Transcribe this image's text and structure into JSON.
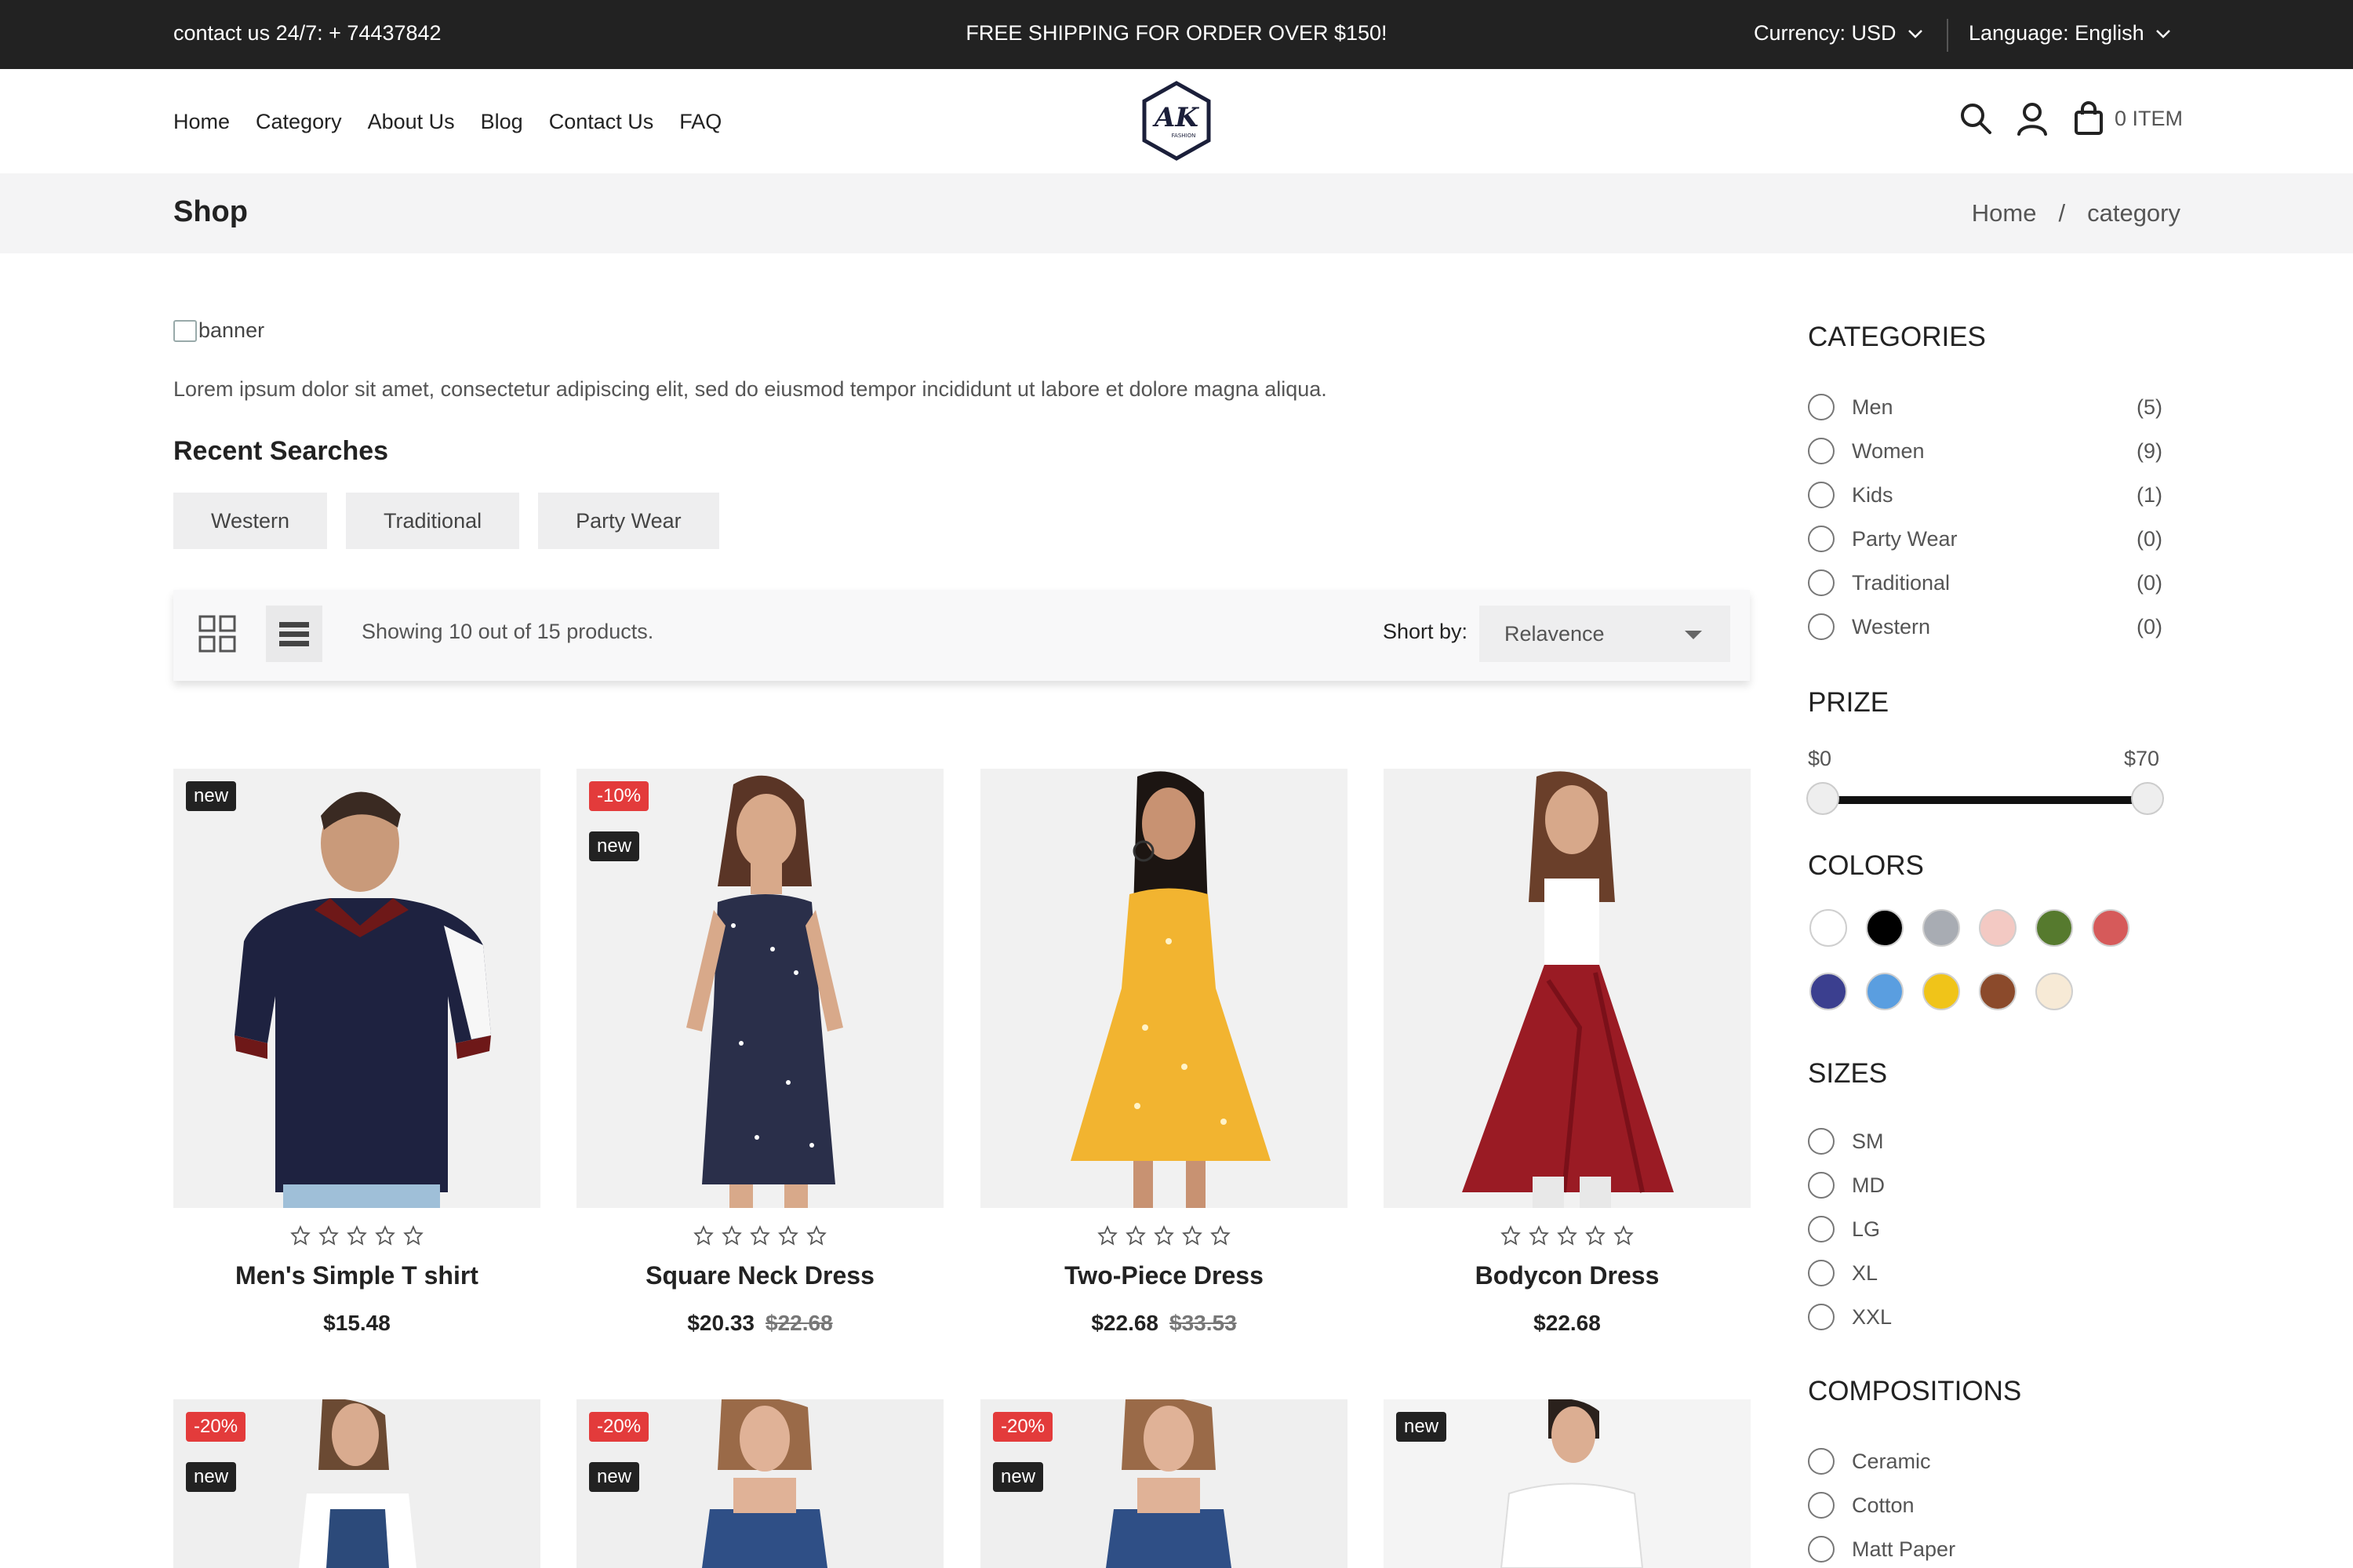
{
  "topbar": {
    "contact": "contact us 24/7: + 74437842",
    "shipping": "FREE SHIPPING FOR ORDER OVER $150!",
    "currency": "Currency: USD",
    "language": "Language: English"
  },
  "nav": {
    "items": [
      "Home",
      "Category",
      "About Us",
      "Blog",
      "Contact Us",
      "FAQ"
    ]
  },
  "logo": {
    "text": "AK",
    "subtext": "FASHION"
  },
  "cart": {
    "label": "0 ITEM"
  },
  "page": {
    "title": "Shop"
  },
  "breadcrumb": {
    "home": "Home",
    "separator": "/",
    "current": "category"
  },
  "banner": {
    "alt": "banner"
  },
  "description": "Lorem ipsum dolor sit amet, consectetur adipiscing elit, sed do eiusmod tempor incididunt ut labore et dolore magna aliqua.",
  "recent_searches": {
    "title": "Recent Searches",
    "items": [
      "Western",
      "Traditional",
      "Party Wear"
    ]
  },
  "toolbar": {
    "showing": "Showing 10 out of 15 products.",
    "sort_label": "Short by:",
    "sort_value": "Relavence"
  },
  "products": [
    {
      "name": "Men's Simple T shirt",
      "price": "$15.48",
      "old_price": "",
      "sale": "",
      "new": "new",
      "rating": 0,
      "bg": "#f1f1f1"
    },
    {
      "name": "Square Neck Dress",
      "price": "$20.33",
      "old_price": "$22.68",
      "sale": "-10%",
      "new": "new",
      "rating": 0,
      "bg": "#f1f1f1"
    },
    {
      "name": "Two-Piece Dress",
      "price": "$22.68",
      "old_price": "$33.53",
      "sale": "",
      "new": "",
      "rating": 0,
      "bg": "#f1f1f1"
    },
    {
      "name": "Bodycon Dress",
      "price": "$22.68",
      "old_price": "",
      "sale": "",
      "new": "",
      "rating": 0,
      "bg": "#f1f1f1"
    },
    {
      "sale": "-20%",
      "new": "new",
      "bg": "#efefef"
    },
    {
      "sale": "-20%",
      "new": "new",
      "bg": "#efefef"
    },
    {
      "sale": "-20%",
      "new": "new",
      "bg": "#efefef"
    },
    {
      "sale": "",
      "new": "new",
      "bg": "#f4f4f4"
    }
  ],
  "sidebar": {
    "categories_title": "CATEGORIES",
    "categories": [
      {
        "label": "Men",
        "count": "(5)"
      },
      {
        "label": "Women",
        "count": "(9)"
      },
      {
        "label": "Kids",
        "count": "(1)"
      },
      {
        "label": "Party Wear",
        "count": "(0)"
      },
      {
        "label": "Traditional",
        "count": "(0)"
      },
      {
        "label": "Western",
        "count": "(0)"
      }
    ],
    "price_title": "PRIZE",
    "price_min": "$0",
    "price_max": "$70",
    "colors_title": "COLORS",
    "colors": [
      "#ffffff",
      "#000000",
      "#a8acb3",
      "#f3c9c3",
      "#567a2e",
      "#d65a5a",
      "#3b3f8f",
      "#5a9ee0",
      "#f0c419",
      "#8b4a2b",
      "#f7ead6"
    ],
    "sizes_title": "SIZES",
    "sizes": [
      "SM",
      "MD",
      "LG",
      "XL",
      "XXL"
    ],
    "compositions_title": "COMPOSITIONS",
    "compositions": [
      "Ceramic",
      "Cotton",
      "Matt Paper"
    ]
  }
}
